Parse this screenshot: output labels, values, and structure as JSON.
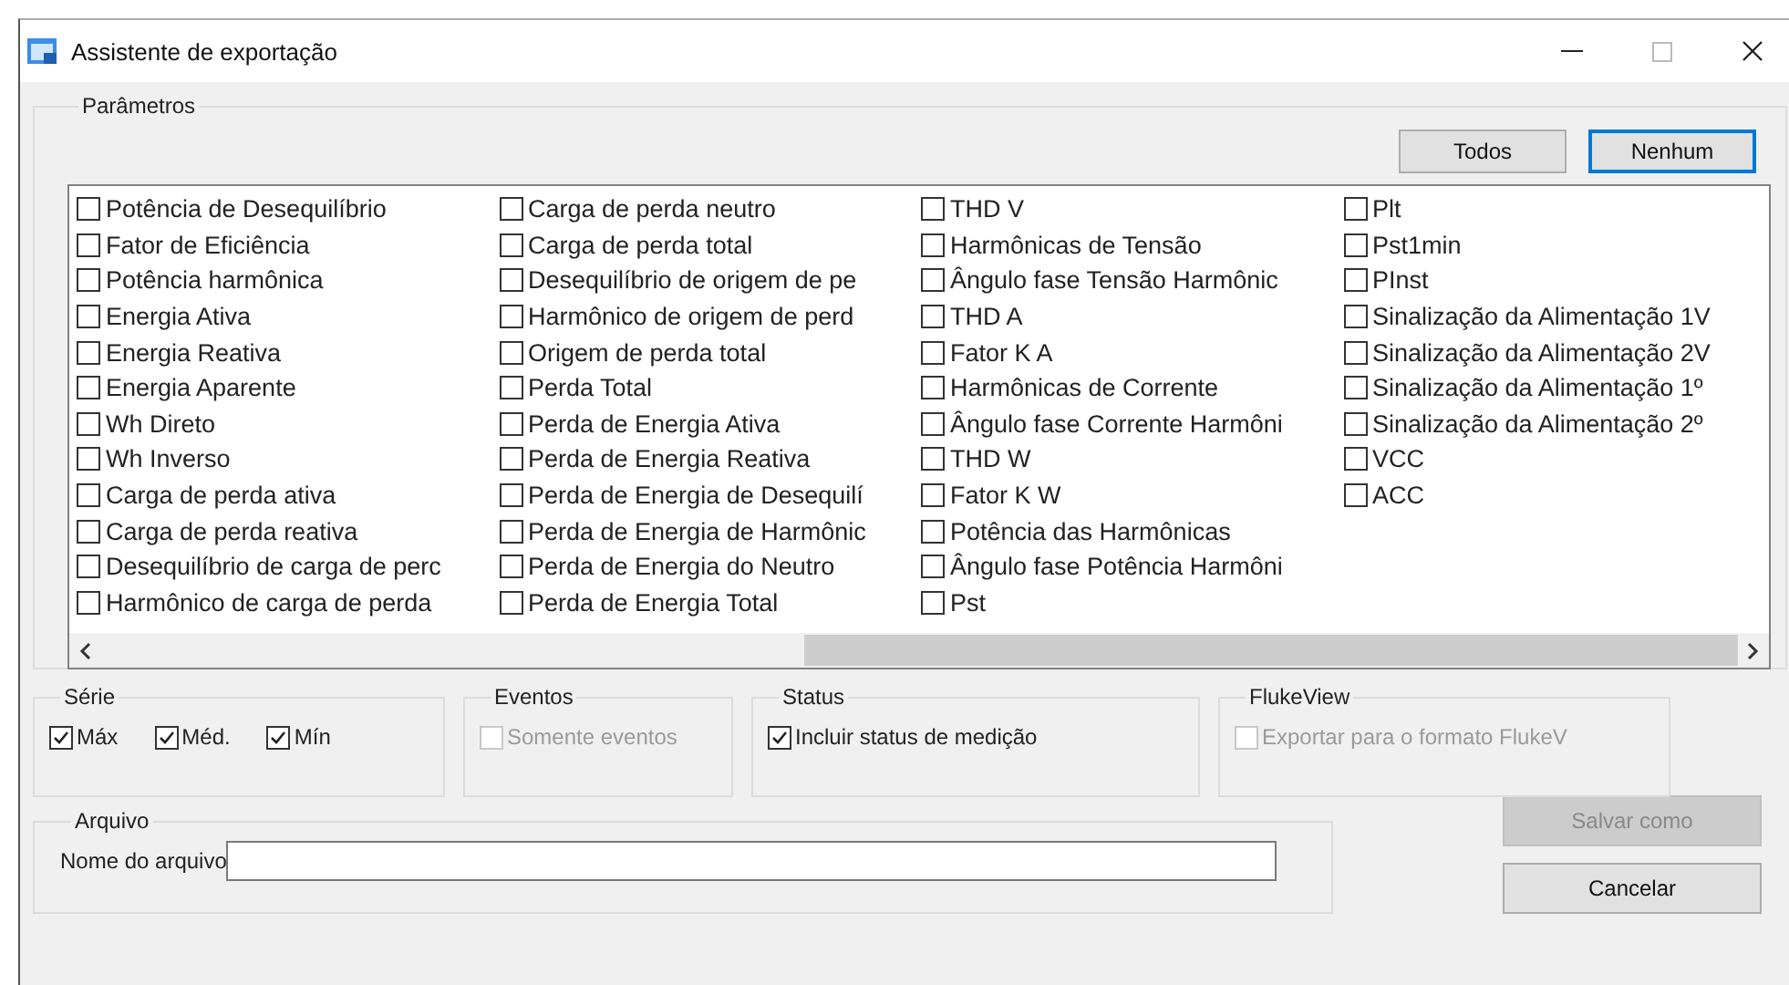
{
  "window": {
    "title": "Assistente de exportação"
  },
  "parameters": {
    "title": "Parâmetros",
    "buttons": [
      {
        "label": "Todos",
        "selected": false
      },
      {
        "label": "Nenhum",
        "selected": true
      }
    ],
    "items": [
      {
        "label": "Potência de Desequilíbrio",
        "checked": false
      },
      {
        "label": "Fator de Eficiência",
        "checked": false
      },
      {
        "label": "Potência harmônica",
        "checked": false
      },
      {
        "label": "Energia Ativa",
        "checked": false
      },
      {
        "label": "Energia Reativa",
        "checked": false
      },
      {
        "label": "Energia Aparente",
        "checked": false
      },
      {
        "label": "Wh Direto",
        "checked": false
      },
      {
        "label": "Wh Inverso",
        "checked": false
      },
      {
        "label": "Carga de perda ativa",
        "checked": false
      },
      {
        "label": "Carga de perda reativa",
        "checked": false
      },
      {
        "label": "Desequilíbrio de carga de perc",
        "checked": false
      },
      {
        "label": "Harmônico de carga de perda",
        "checked": false
      },
      {
        "label": "Carga de perda neutro",
        "checked": false
      },
      {
        "label": "Carga de perda total",
        "checked": false
      },
      {
        "label": "Desequilíbrio de origem de pe",
        "checked": false
      },
      {
        "label": "Harmônico de origem de perd",
        "checked": false
      },
      {
        "label": "Origem de perda total",
        "checked": false
      },
      {
        "label": "Perda Total",
        "checked": false
      },
      {
        "label": "Perda de Energia Ativa",
        "checked": false
      },
      {
        "label": "Perda de Energia Reativa",
        "checked": false
      },
      {
        "label": "Perda de Energia de Desequilí",
        "checked": false
      },
      {
        "label": "Perda de Energia de Harmônic",
        "checked": false
      },
      {
        "label": "Perda de Energia do Neutro",
        "checked": false
      },
      {
        "label": "Perda de Energia Total",
        "checked": false
      },
      {
        "label": "THD V",
        "checked": false
      },
      {
        "label": "Harmônicas de Tensão",
        "checked": false
      },
      {
        "label": "Ângulo fase Tensão Harmônic",
        "checked": false
      },
      {
        "label": "THD A",
        "checked": false
      },
      {
        "label": "Fator K A",
        "checked": false
      },
      {
        "label": "Harmônicas de Corrente",
        "checked": false
      },
      {
        "label": "Ângulo fase Corrente Harmôni",
        "checked": false
      },
      {
        "label": "THD W",
        "checked": false
      },
      {
        "label": "Fator K W",
        "checked": false
      },
      {
        "label": "Potência das Harmônicas",
        "checked": false
      },
      {
        "label": "Ângulo fase Potência Harmôni",
        "checked": false
      },
      {
        "label": "Pst",
        "checked": false
      },
      {
        "label": "Plt",
        "checked": false
      },
      {
        "label": "Pst1min",
        "checked": false
      },
      {
        "label": "PInst",
        "checked": false
      },
      {
        "label": "Sinalização da Alimentação 1V",
        "checked": false
      },
      {
        "label": "Sinalização da Alimentação 2V",
        "checked": false
      },
      {
        "label": "Sinalização da Alimentação 1º",
        "checked": false
      },
      {
        "label": "Sinalização da Alimentação 2º",
        "checked": false
      },
      {
        "label": "VCC",
        "checked": false
      },
      {
        "label": "ACC",
        "checked": false
      }
    ]
  },
  "serie": {
    "title": "Série",
    "options": [
      {
        "label": "Máx",
        "checked": true
      },
      {
        "label": "Méd.",
        "checked": true
      },
      {
        "label": "Mín",
        "checked": true
      }
    ]
  },
  "eventos": {
    "title": "Eventos",
    "option": {
      "label": "Somente eventos",
      "checked": false,
      "disabled": true
    }
  },
  "status": {
    "title": "Status",
    "option": {
      "label": "Incluir status de medição",
      "checked": true,
      "disabled": false
    }
  },
  "flukeview": {
    "title": "FlukeView",
    "option": {
      "label": "Exportar para o formato FlukeV",
      "checked": false,
      "disabled": true
    }
  },
  "arquivo": {
    "title": "Arquivo",
    "label": "Nome do arquivo"
  },
  "buttons": [
    {
      "label": "Salvar como",
      "disabled": true
    },
    {
      "label": "Cancelar",
      "disabled": false
    }
  ]
}
